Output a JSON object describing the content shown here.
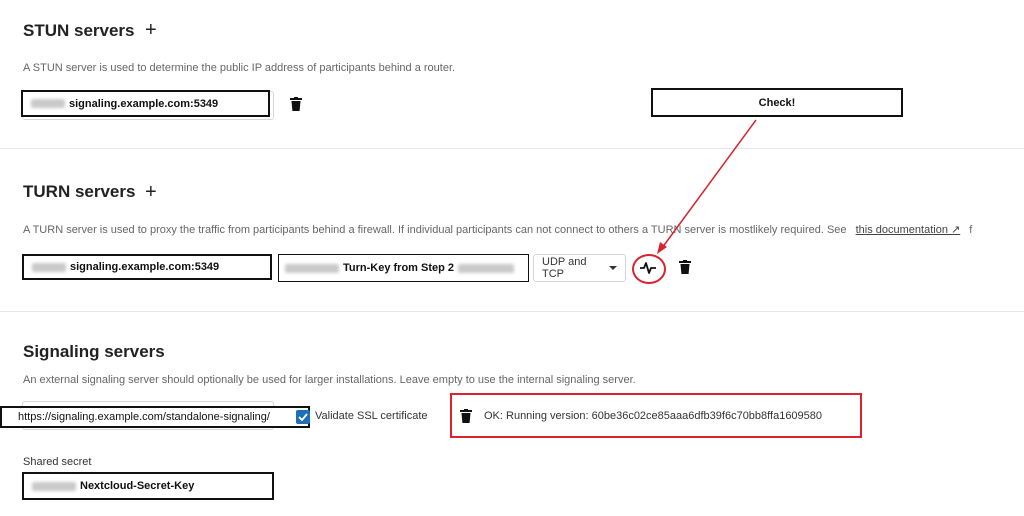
{
  "stun": {
    "title": "STUN servers",
    "description": "A STUN server is used to determine the public IP address of participants behind a router.",
    "server_value": "signaling.example.com:5349"
  },
  "annotation": {
    "check_label": "Check!"
  },
  "turn": {
    "title": "TURN servers",
    "description": "A TURN server is used to proxy the traffic from participants behind a firewall. If individual participants can not connect to others a TURN server is mostlikely required. See",
    "doc_link": "this documentation ↗",
    "trailing_text": "f",
    "server_value": "signaling.example.com:5349",
    "secret_value": "Turn-Key from Step 2",
    "protocol_selected": "UDP and TCP"
  },
  "signaling": {
    "title": "Signaling servers",
    "description": "An external signaling server should optionally be used for larger installations. Leave empty to use the internal signaling server.",
    "server_value": "https://signaling.example.com/standalone-signaling/",
    "validate_label": "Validate SSL certificate",
    "status_text": "OK: Running version: 60be36c02ce85aaa6dfb39f6c70bb8ffa1609580",
    "shared_secret_label": "Shared secret",
    "shared_secret_value": "Nextcloud-Secret-Key"
  },
  "colors": {
    "annotation_red": "#d9232f",
    "checkbox_blue": "#1d6fb8"
  }
}
